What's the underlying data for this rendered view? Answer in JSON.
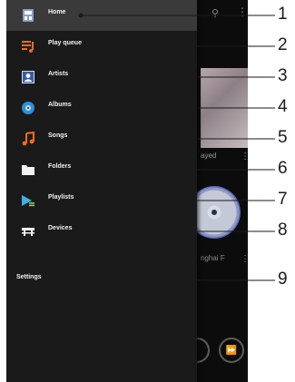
{
  "drawer": {
    "items": [
      {
        "label": "Home",
        "icon": "home-icon",
        "active": true
      },
      {
        "label": "Play queue",
        "icon": "play-queue-icon"
      },
      {
        "label": "Artists",
        "icon": "artist-icon"
      },
      {
        "label": "Albums",
        "icon": "album-icon"
      },
      {
        "label": "Songs",
        "icon": "music-note-icon"
      },
      {
        "label": "Folders",
        "icon": "folder-icon"
      },
      {
        "label": "Playlists",
        "icon": "playlist-icon"
      },
      {
        "label": "Devices",
        "icon": "devices-icon"
      }
    ],
    "settings_label": "Settings"
  },
  "background": {
    "played_text": "ayed",
    "artist_text": "nghai F"
  },
  "callouts": [
    "1",
    "2",
    "3",
    "4",
    "5",
    "6",
    "7",
    "8",
    "9"
  ],
  "colors": {
    "drawer_bg": "#1a1a1a",
    "active_bg": "#3a3a3a",
    "accent_orange": "#f26a1b",
    "accent_blue": "#2d8fd8"
  }
}
